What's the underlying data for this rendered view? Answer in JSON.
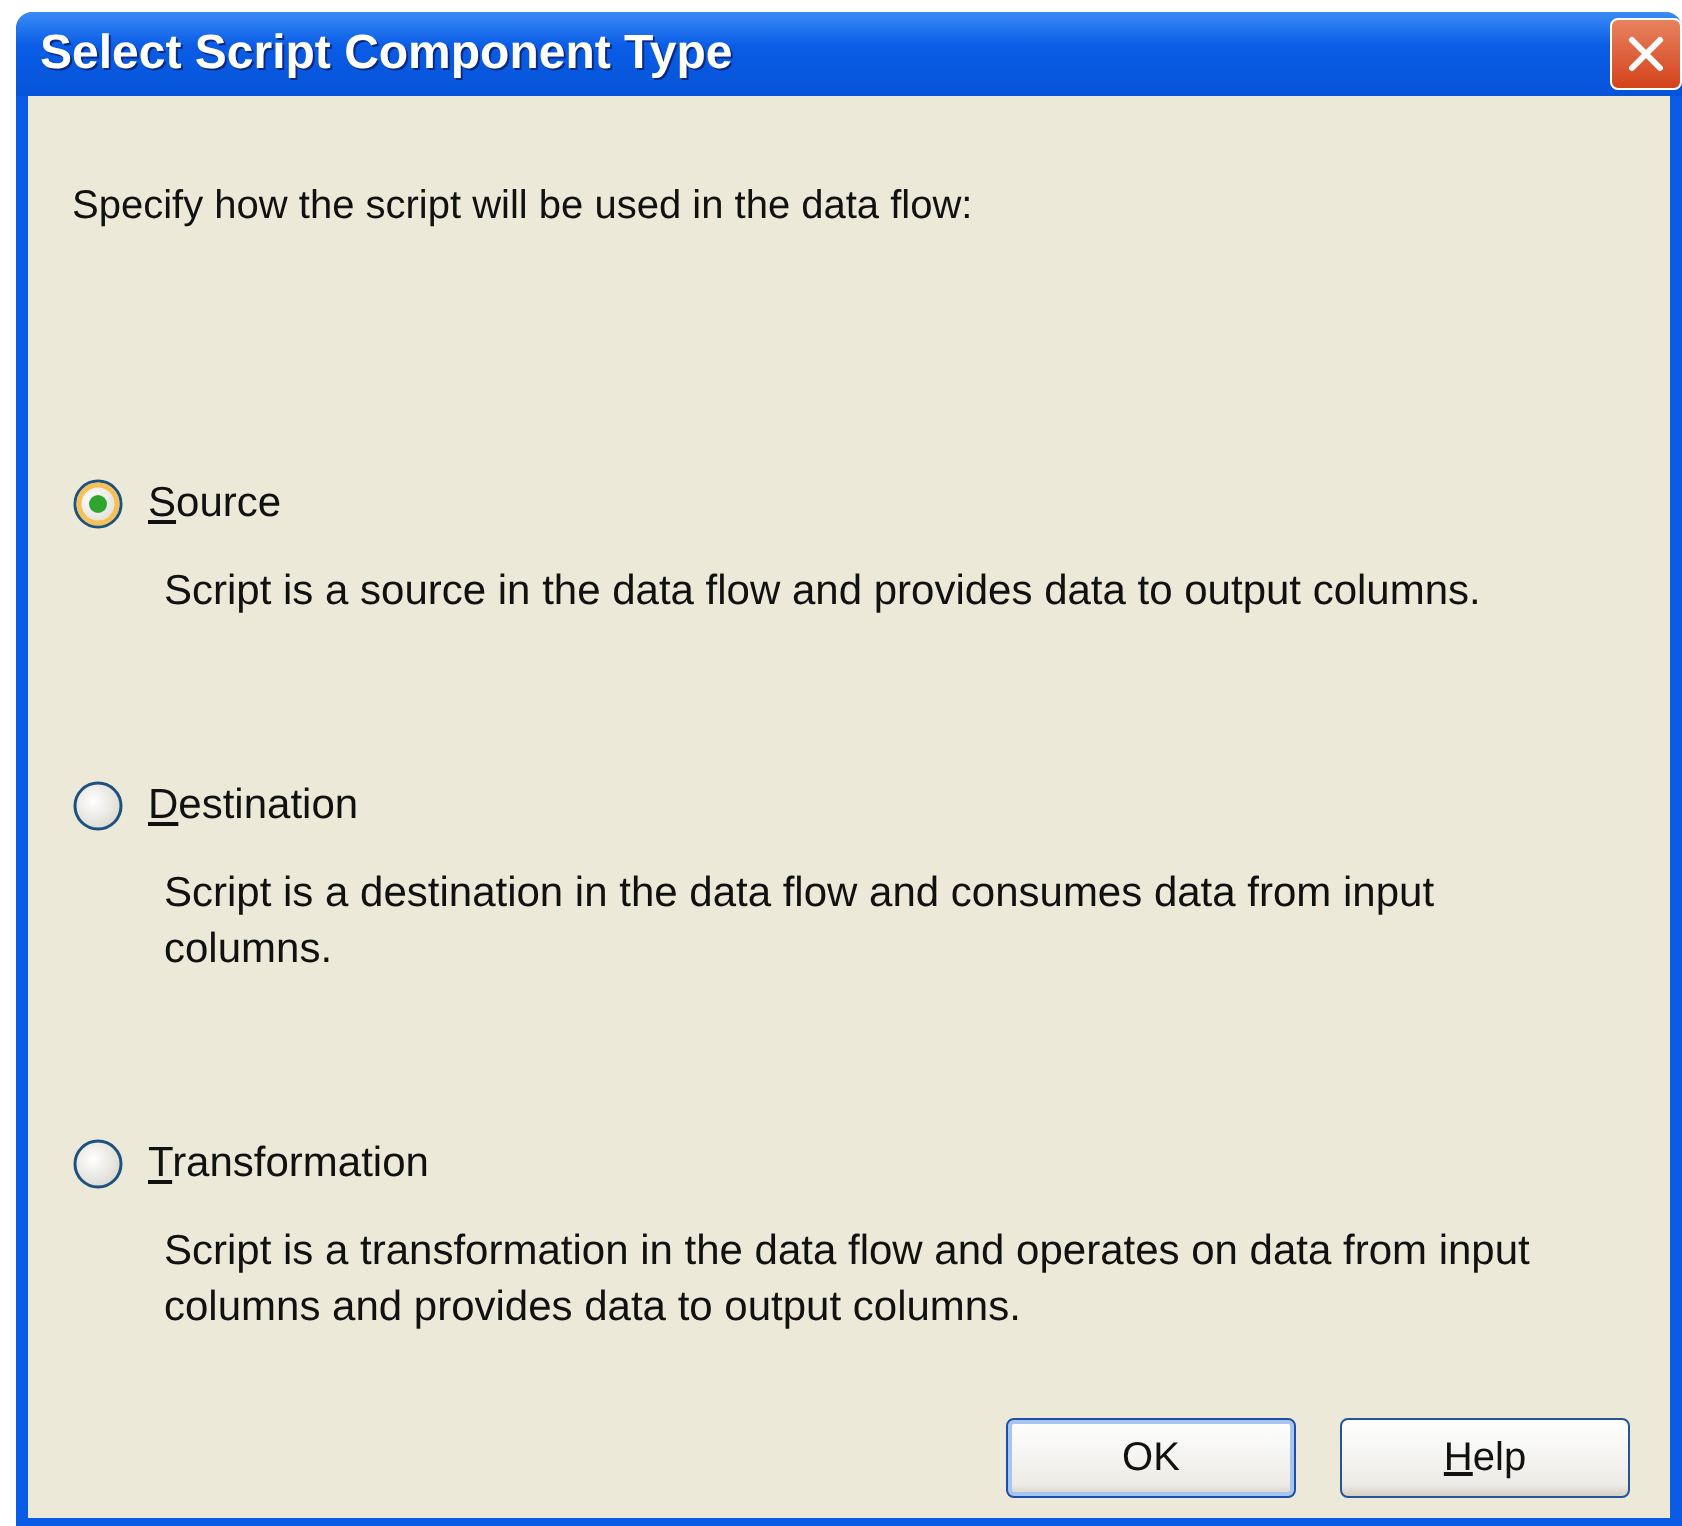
{
  "window": {
    "title": "Select Script Component Type"
  },
  "prompt": "Specify how the script will be used in the data flow:",
  "options": [
    {
      "label": "Source",
      "first_letter_underlined": true,
      "selected": true,
      "description": "Script is a source in the data flow and provides data to output columns."
    },
    {
      "label": "Destination",
      "first_letter_underlined": true,
      "selected": false,
      "description": "Script is a destination in the data flow and consumes data from input columns."
    },
    {
      "label": "Transformation",
      "first_letter_underlined": true,
      "selected": false,
      "description": "Script is a transformation in the data flow and operates on data from input columns and provides data to output columns."
    }
  ],
  "buttons": [
    {
      "label": "OK",
      "first_letter_underlined": false,
      "default": true
    },
    {
      "label": "Help",
      "first_letter_underlined": true,
      "default": false
    }
  ]
}
